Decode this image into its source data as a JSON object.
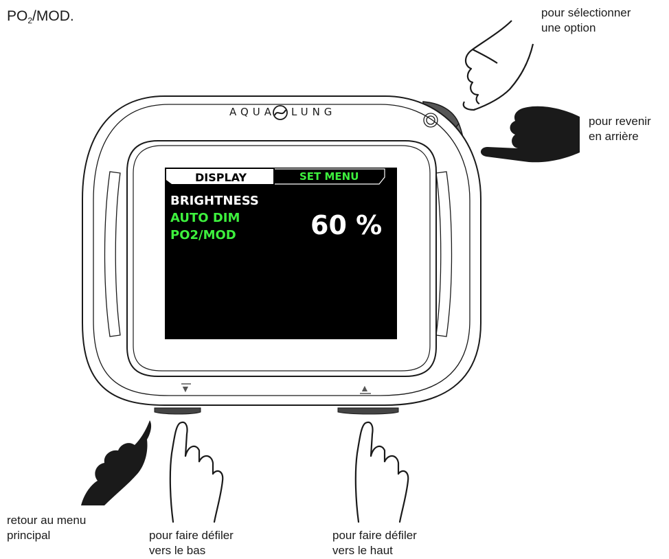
{
  "title": {
    "main": "PO",
    "sub": "2",
    "rest": "/MOD."
  },
  "brand": {
    "left": "AQUA",
    "right": "LUNG"
  },
  "screen": {
    "tab_display": "DISPLAY",
    "tab_set_menu": "SET MENU",
    "menu_items": [
      {
        "label": "BRIGHTNESS",
        "color": "#ffffff"
      },
      {
        "label": "AUTO DIM",
        "color": "#3df03d"
      },
      {
        "label": "PO2/MOD",
        "color": "#3df03d"
      }
    ],
    "value": "60 %"
  },
  "buttons": {
    "down_symbol": "▼",
    "up_symbol": "▲"
  },
  "annotations": {
    "select_line1": "pour sélectionner",
    "select_line2": "une option",
    "back_line1": "pour revenir",
    "back_line2": "en arrière",
    "main_menu_line1": "retour au menu",
    "main_menu_line2": "principal",
    "scroll_down_line1": "pour faire défiler",
    "scroll_down_line2": "vers le bas",
    "scroll_up_line1": "pour faire défiler",
    "scroll_up_line2": "vers le haut"
  },
  "colors": {
    "accent_green": "#3df03d",
    "screen_bg": "#000000",
    "outline": "#1a1a1a"
  },
  "icons": [
    "pointing-hand-icon",
    "pressing-hand-icon",
    "aqualung-logo-icon",
    "light-sensor-icon"
  ]
}
